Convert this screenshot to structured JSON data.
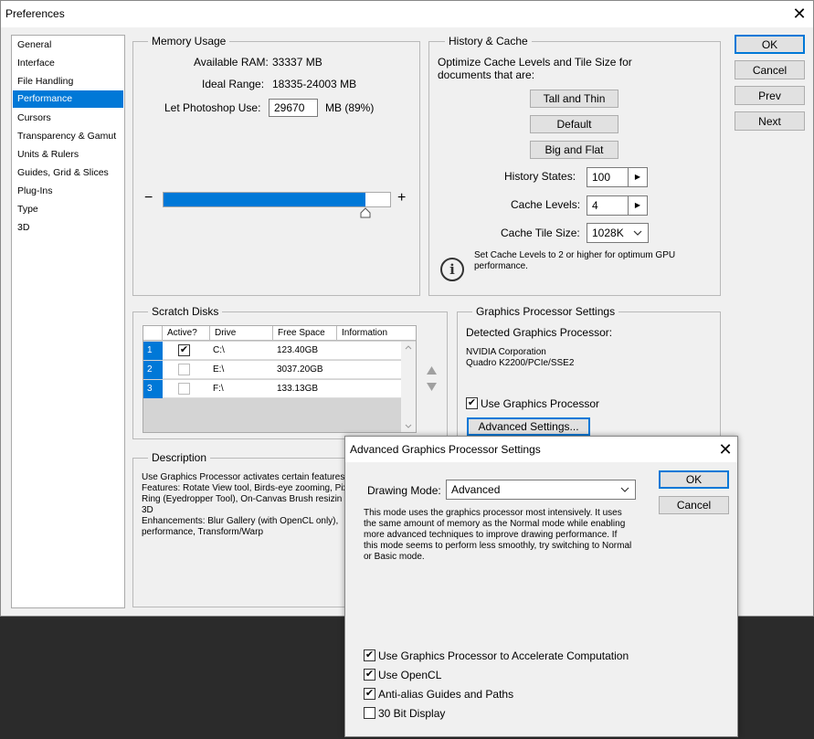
{
  "window": {
    "title": "Preferences",
    "close_glyph": "✕"
  },
  "nav": {
    "items": [
      {
        "label": "General",
        "selected": false
      },
      {
        "label": "Interface",
        "selected": false
      },
      {
        "label": "File Handling",
        "selected": false
      },
      {
        "label": "Performance",
        "selected": true
      },
      {
        "label": "Cursors",
        "selected": false
      },
      {
        "label": "Transparency & Gamut",
        "selected": false
      },
      {
        "label": "Units & Rulers",
        "selected": false
      },
      {
        "label": "Guides, Grid & Slices",
        "selected": false
      },
      {
        "label": "Plug-Ins",
        "selected": false
      },
      {
        "label": "Type",
        "selected": false
      },
      {
        "label": "3D",
        "selected": false
      }
    ]
  },
  "buttons": {
    "ok": "OK",
    "cancel": "Cancel",
    "prev": "Prev",
    "next": "Next"
  },
  "memory": {
    "title": "Memory Usage",
    "available_label": "Available RAM:",
    "available_value": "33337 MB",
    "ideal_label": "Ideal Range:",
    "ideal_value": "18335-24003 MB",
    "use_label": "Let Photoshop Use:",
    "use_value": "29670",
    "use_suffix": "MB (89%)",
    "slider_fraction": 0.89,
    "minus": "−",
    "plus": "+"
  },
  "history": {
    "title": "History & Cache",
    "desc": "Optimize Cache Levels and Tile Size for documents that are:",
    "btn_tall": "Tall and Thin",
    "btn_default": "Default",
    "btn_big": "Big and Flat",
    "states_label": "History States:",
    "states_value": "100",
    "levels_label": "Cache Levels:",
    "levels_value": "4",
    "tile_label": "Cache Tile Size:",
    "tile_value": "1028K",
    "note": "Set Cache Levels to 2 or higher for optimum GPU performance.",
    "info_glyph": "i"
  },
  "scratch": {
    "title": "Scratch Disks",
    "headers": [
      "Active?",
      "Drive",
      "Free Space",
      "Information"
    ],
    "rows": [
      {
        "num": "1",
        "active": true,
        "drive": "C:\\",
        "free": "123.40GB",
        "info": ""
      },
      {
        "num": "2",
        "active": false,
        "drive": "E:\\",
        "free": "3037.20GB",
        "info": ""
      },
      {
        "num": "3",
        "active": false,
        "drive": "F:\\",
        "free": "133.13GB",
        "info": ""
      }
    ]
  },
  "gpu": {
    "title": "Graphics Processor Settings",
    "detected_label": "Detected Graphics Processor:",
    "vendor": "NVIDIA Corporation",
    "model": "Quadro K2200/PCIe/SSE2",
    "use_label": "Use Graphics Processor",
    "use_checked": true,
    "advanced_button": "Advanced Settings..."
  },
  "description": {
    "title": "Description",
    "lines": [
      "Use Graphics Processor activates certain features a",
      "Features: Rotate View tool, Birds-eye zooming, Pix",
      "Ring (Eyedropper Tool), On-Canvas Brush resizin",
      "3D",
      "Enhancements: Blur Gallery (with OpenCL only),",
      "performance, Transform/Warp"
    ]
  },
  "advanced": {
    "title": "Advanced Graphics Processor Settings",
    "mode_label": "Drawing Mode:",
    "mode_value": "Advanced",
    "ok": "OK",
    "cancel": "Cancel",
    "mode_desc": [
      "This mode uses the graphics processor most intensively.  It uses",
      "the same amount of memory as the Normal mode while enabling",
      "more advanced techniques to improve drawing performance.  If",
      "this mode seems to perform less smoothly, try switching to Normal",
      "or Basic mode."
    ],
    "options": [
      {
        "label": "Use Graphics Processor to Accelerate Computation",
        "checked": true
      },
      {
        "label": "Use OpenCL",
        "checked": true
      },
      {
        "label": "Anti-alias Guides and Paths",
        "checked": true
      },
      {
        "label": "30 Bit Display",
        "checked": false
      }
    ]
  },
  "colors": {
    "accent": "#0078d7",
    "dialog_bg": "#f0f0f0",
    "desktop": "#2b2b2b"
  }
}
